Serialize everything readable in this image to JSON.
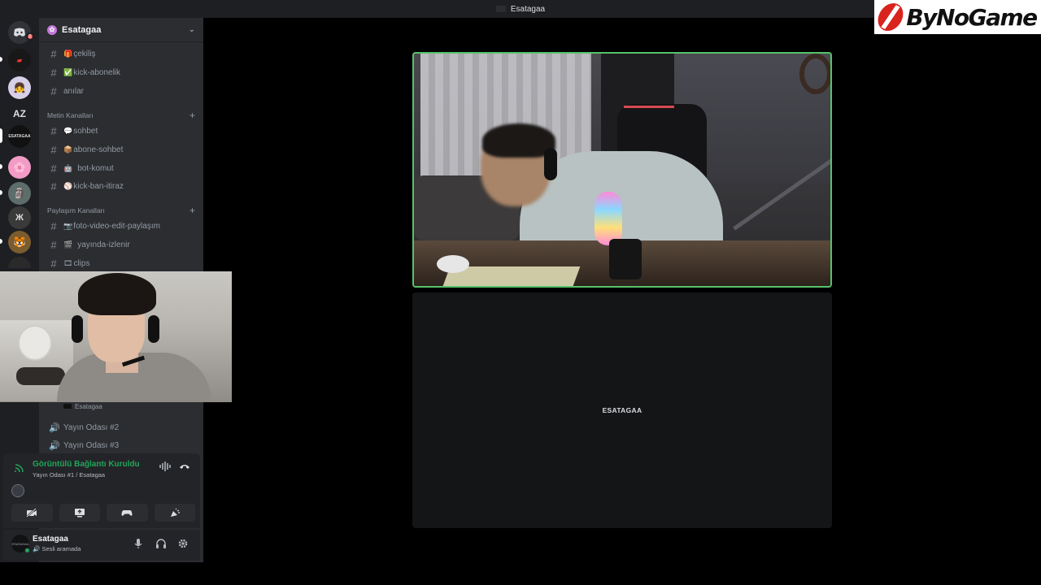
{
  "titlebar": {
    "title": "Esatagaa"
  },
  "watermark": {
    "text": "ByNoGame"
  },
  "rail": {
    "badge_count": "8",
    "az_label": "AZ",
    "active_server_label": "ESATAGAA"
  },
  "sidebar": {
    "guild_name": "Esatagaa",
    "channels_top": [
      {
        "emoji": "🎁",
        "name": "çekiliş"
      },
      {
        "emoji": "✅",
        "name": "kick-abonelik"
      },
      {
        "emoji": "",
        "name": "anılar"
      }
    ],
    "category_text": "Metin Kanalları",
    "text_channels": [
      {
        "emoji": "💬",
        "name": "sohbet"
      },
      {
        "emoji": "📦",
        "name": "abone-sohbet"
      },
      {
        "emoji": "🤖",
        "name": "bot-komut"
      },
      {
        "emoji": "⚾",
        "name": "kick-ban-itiraz"
      }
    ],
    "category_share": "Paylaşım Kanalları",
    "share_channels": [
      {
        "emoji": "📷",
        "name": "foto-video-edit-paylaşım"
      },
      {
        "emoji": "🎬",
        "name": "yayında-izlenir"
      },
      {
        "emoji": "🎞",
        "name": "clips"
      }
    ],
    "voice_member": "Esatagaa",
    "voice_channels": [
      {
        "name": "Yayın Odası #2"
      },
      {
        "name": "Yayın Odası #3"
      }
    ]
  },
  "voice_panel": {
    "status": "Görüntülü Bağlantı Kuruldu",
    "subtitle": "Yayın Odası #1 / Esatagaa",
    "accent": "#23a559"
  },
  "user_panel": {
    "name": "Esatagaa",
    "status": "Sesli aramada",
    "avatar_text": "ESATAGAA"
  },
  "stage": {
    "bottom_tile_name": "ESATAGAA",
    "speaking_border": "#57c26a"
  }
}
